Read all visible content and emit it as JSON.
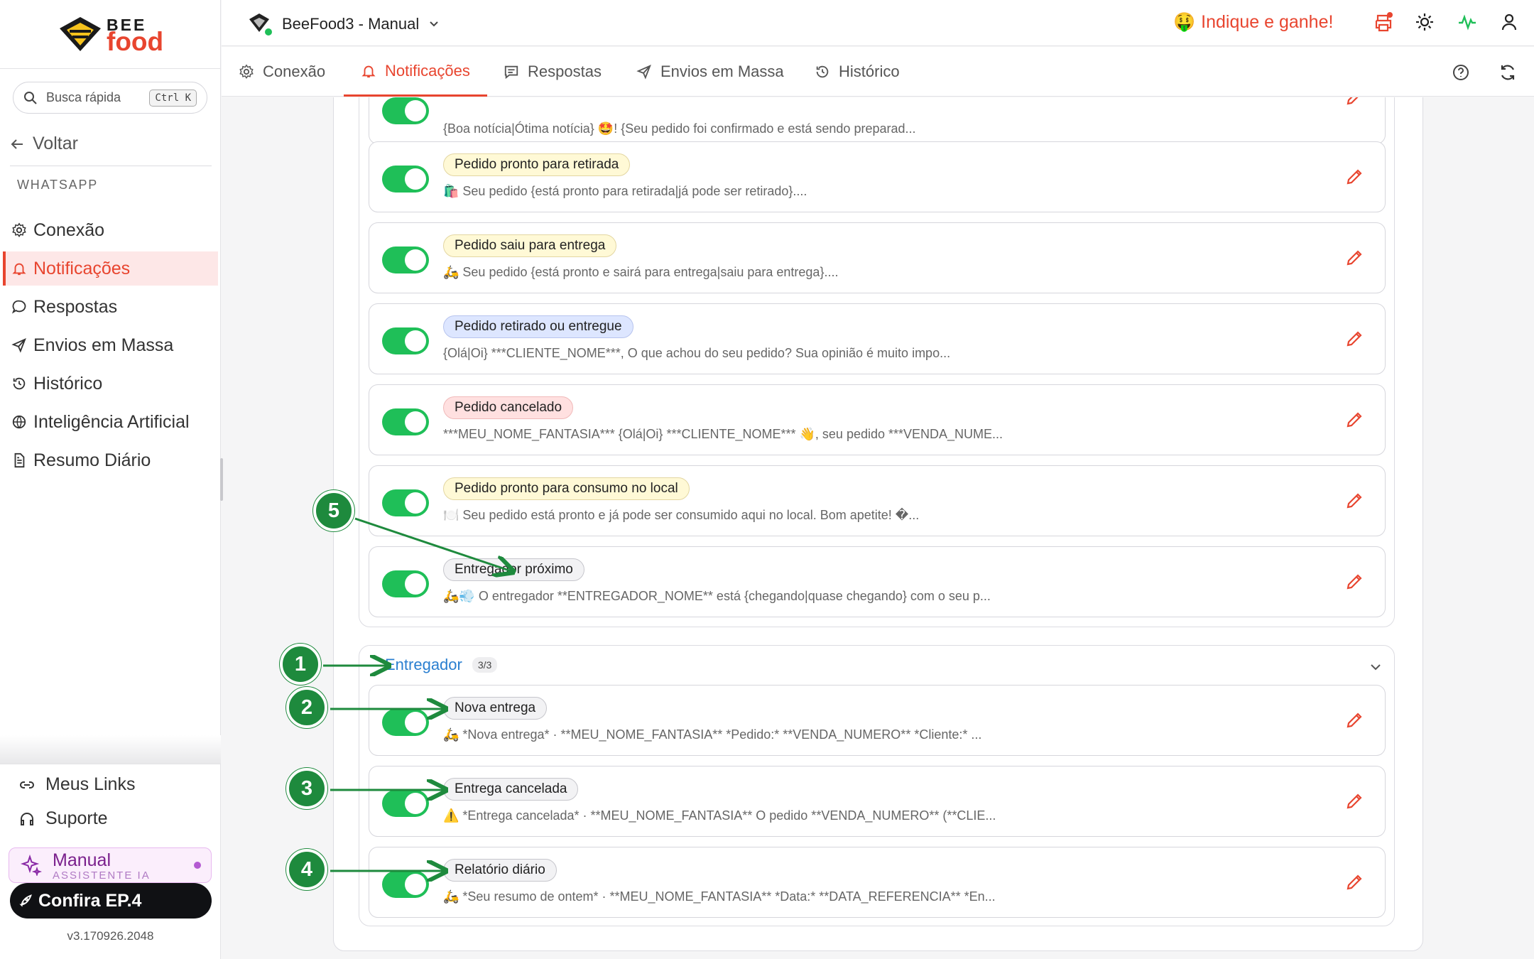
{
  "brand": {
    "line1": "BEE",
    "line2": "food"
  },
  "sidebar": {
    "search": {
      "placeholder": "Busca rápida",
      "shortcut": "Ctrl K"
    },
    "back": "Voltar",
    "section": "WHATSAPP",
    "items": [
      {
        "label": "Conexão",
        "icon": "gear-icon"
      },
      {
        "label": "Notificações",
        "icon": "bell-icon",
        "active": true
      },
      {
        "label": "Respostas",
        "icon": "chat-icon"
      },
      {
        "label": "Envios em Massa",
        "icon": "send-icon"
      },
      {
        "label": "Histórico",
        "icon": "history-icon"
      },
      {
        "label": "Inteligência Artificial",
        "icon": "globe-icon"
      },
      {
        "label": "Resumo Diário",
        "icon": "document-icon"
      }
    ],
    "bottom": [
      {
        "label": "Meus Links",
        "icon": "link-icon"
      },
      {
        "label": "Suporte",
        "icon": "headset-icon"
      }
    ],
    "manual": {
      "title": "Manual",
      "subtitle": "ASSISTENTE IA"
    },
    "confira": "Confira EP.4",
    "version": "v3.170926.2048"
  },
  "header": {
    "app": "BeeFood3 - Manual",
    "promo": "Indique e ganhe!",
    "promo_emoji": "🤑"
  },
  "tabs": [
    {
      "label": "Conexão",
      "icon": "gear-icon"
    },
    {
      "label": "Notificações",
      "icon": "bell-icon",
      "active": true
    },
    {
      "label": "Respostas",
      "icon": "chat-icon"
    },
    {
      "label": "Envios em Massa",
      "icon": "send-icon"
    },
    {
      "label": "Histórico",
      "icon": "history-icon"
    }
  ],
  "top_card": {
    "desc": "{Boa notícia|Ótima notícia} 🤩! {Seu pedido foi confirmado e está sendo preparad..."
  },
  "notifications": [
    {
      "title": "Pedido pronto para retirada",
      "desc": "🛍️ Seu pedido {está pronto para retirada|já pode ser retirado}...."
    },
    {
      "title": "Pedido saiu para entrega",
      "desc": "🛵 Seu pedido {está pronto e sairá para entrega|saiu para entrega}...."
    },
    {
      "title": "Pedido retirado ou entregue",
      "desc": "{Olá|Oi} ***CLIENTE_NOME***, O que achou do seu pedido? Sua opinião é muito impo..."
    },
    {
      "title": "Pedido cancelado",
      "desc": "***MEU_NOME_FANTASIA*** {Olá|Oi} ***CLIENTE_NOME*** 👋, seu pedido ***VENDA_NUME..."
    },
    {
      "title": "Pedido pronto para consumo no local",
      "desc": "🍽️ Seu pedido está pronto e já pode ser consumido aqui no local. Bom apetite! �..."
    },
    {
      "title": "Entregador próximo",
      "desc": "🛵💨 O entregador **ENTREGADOR_NOME** está {chegando|quase chegando} com o seu p..."
    }
  ],
  "group2": {
    "title": "Entregador",
    "count": "3/3"
  },
  "courier": [
    {
      "title": "Nova entrega",
      "desc": "🛵 *Nova entrega* · **MEU_NOME_FANTASIA** *Pedido:* **VENDA_NUMERO** *Cliente:* ..."
    },
    {
      "title": "Entrega cancelada",
      "desc": "⚠️ *Entrega cancelada* · **MEU_NOME_FANTASIA** O pedido **VENDA_NUMERO** (**CLIE..."
    },
    {
      "title": "Relatório diário",
      "desc": "🛵 *Seu resumo de ontem* · **MEU_NOME_FANTASIA** *Data:* **DATA_REFERENCIA** *En..."
    }
  ],
  "markers": [
    "1",
    "2",
    "3",
    "4",
    "5"
  ],
  "colors": {
    "accent": "#e8452f",
    "toggle_on": "#1fbf58",
    "marker": "#1e8a3d",
    "link": "#2a7fd0"
  }
}
